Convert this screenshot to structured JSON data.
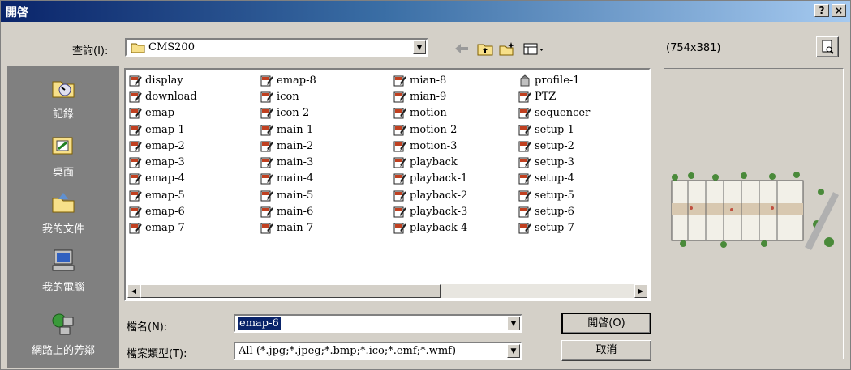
{
  "window": {
    "title": "開啓"
  },
  "titlebar_buttons": {
    "help": "?",
    "close": "×"
  },
  "lookin": {
    "label": "查詢(I):",
    "value": "CMS200"
  },
  "preview_size": "(754x381)",
  "places": [
    {
      "label": "記錄",
      "icon": "history-icon"
    },
    {
      "label": "桌面",
      "icon": "desktop-icon"
    },
    {
      "label": "我的文件",
      "icon": "my-documents-icon"
    },
    {
      "label": "我的電腦",
      "icon": "my-computer-icon"
    },
    {
      "label": "網路上的芳鄰",
      "icon": "network-places-icon"
    }
  ],
  "files": {
    "col1": [
      "display",
      "download",
      "emap",
      "emap-1",
      "emap-2",
      "emap-3",
      "emap-4",
      "emap-5",
      "emap-6",
      "emap-7"
    ],
    "col2": [
      "emap-8",
      "icon",
      "icon-2",
      "main-1",
      "main-2",
      "main-3",
      "main-4",
      "main-5",
      "main-6",
      "main-7"
    ],
    "col3": [
      "mian-8",
      "mian-9",
      "motion",
      "motion-2",
      "motion-3",
      "playback",
      "playback-1",
      "playback-2",
      "playback-3",
      "playback-4"
    ],
    "col4": [
      "profile-1",
      "PTZ",
      "sequencer",
      "setup-1",
      "setup-2",
      "setup-3",
      "setup-4",
      "setup-5",
      "setup-6",
      "setup-7"
    ]
  },
  "filename": {
    "label": "檔名(N):",
    "value": "emap-6"
  },
  "filetype": {
    "label": "檔案類型(T):",
    "value": "All (*.jpg;*.jpeg;*.bmp;*.ico;*.emf;*.wmf)"
  },
  "buttons": {
    "open": "開啓(O)",
    "cancel": "取消"
  },
  "colors": {
    "title_start": "#0a246a",
    "title_end": "#a6caf0",
    "face": "#d4d0c8",
    "selection": "#0a246a"
  }
}
